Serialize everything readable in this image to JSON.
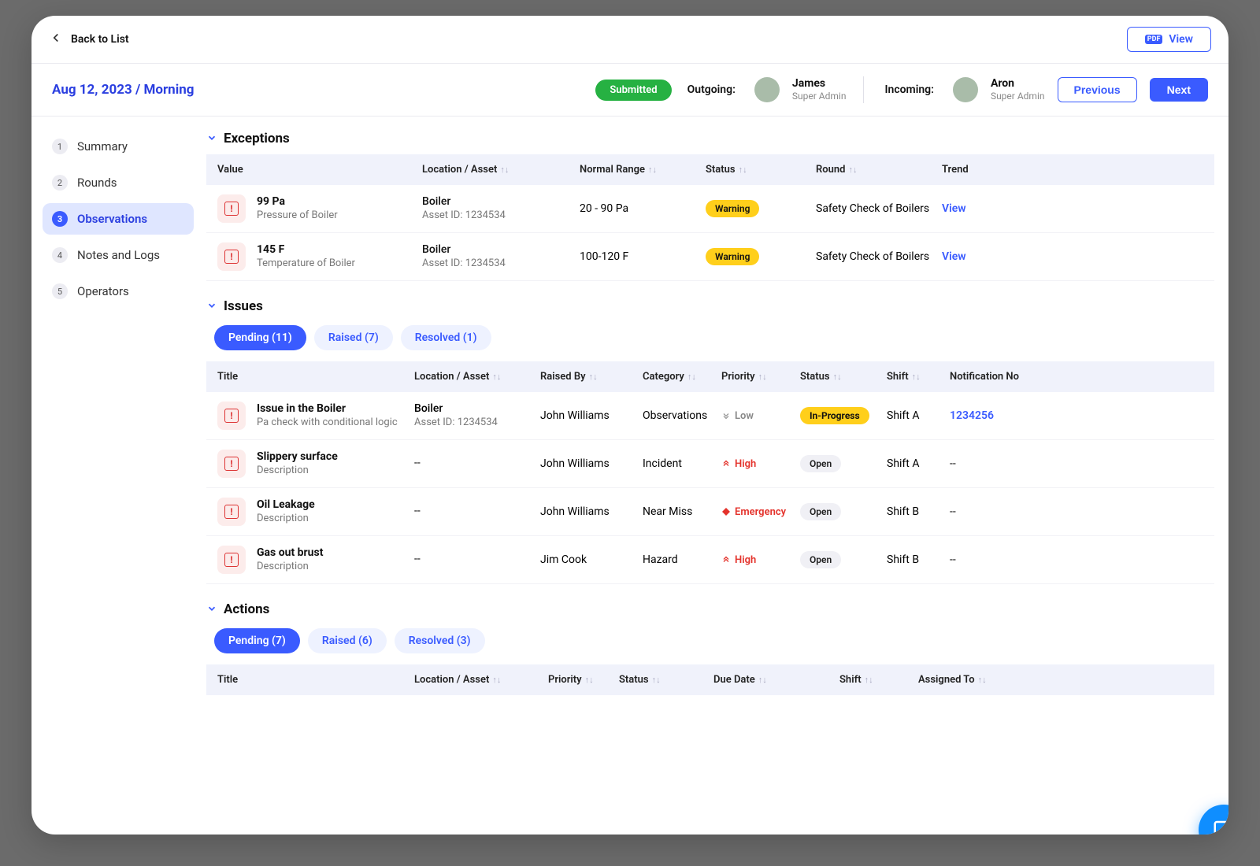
{
  "topbar": {
    "back": "Back to List",
    "view": "View",
    "pdf": "PDF"
  },
  "context": {
    "date": "Aug 12, 2023 / Morning",
    "submitted": "Submitted",
    "outgoing_label": "Outgoing:",
    "incoming_label": "Incoming:",
    "outgoing_name": "James",
    "outgoing_role": "Super Admin",
    "incoming_name": "Aron",
    "incoming_role": "Super Admin",
    "previous": "Previous",
    "next": "Next"
  },
  "sidebar": [
    {
      "num": "1",
      "label": "Summary"
    },
    {
      "num": "2",
      "label": "Rounds"
    },
    {
      "num": "3",
      "label": "Observations"
    },
    {
      "num": "4",
      "label": "Notes and Logs"
    },
    {
      "num": "5",
      "label": "Operators"
    }
  ],
  "exceptions": {
    "title": "Exceptions",
    "headers": {
      "value": "Value",
      "loc": "Location / Asset",
      "range": "Normal Range",
      "status": "Status",
      "round": "Round",
      "trend": "Trend"
    },
    "rows": [
      {
        "val": "99 Pa",
        "desc": "Pressure of Boiler",
        "loc": "Boiler",
        "asset": "Asset ID: 1234534",
        "range": "20 - 90 Pa",
        "status": "Warning",
        "round": "Safety Check of  Boilers",
        "trend": "View"
      },
      {
        "val": "145 F",
        "desc": "Temperature of Boiler",
        "loc": "Boiler",
        "asset": "Asset ID: 1234534",
        "range": "100-120 F",
        "status": "Warning",
        "round": "Safety Check of Boilers",
        "trend": "View"
      }
    ]
  },
  "issues": {
    "title": "Issues",
    "tabs": {
      "pending": "Pending (11)",
      "raised": "Raised (7)",
      "resolved": "Resolved (1)"
    },
    "headers": {
      "title": "Title",
      "loc": "Location / Asset",
      "raisedby": "Raised By",
      "category": "Category",
      "priority": "Priority",
      "status": "Status",
      "shift": "Shift",
      "notif": "Notification No"
    },
    "rows": [
      {
        "title": "Issue in the Boiler",
        "desc": "Pa check with conditional logic",
        "loc": "Boiler",
        "asset": "Asset ID: 1234534",
        "raisedby": "John Williams",
        "category": "Observations",
        "prio": "Low",
        "prio_type": "low",
        "status": "In-Progress",
        "status_type": "prog",
        "shift": "Shift A",
        "notif": "1234256"
      },
      {
        "title": "Slippery surface",
        "desc": "Description",
        "loc": "--",
        "asset": "",
        "raisedby": "John Williams",
        "category": "Incident",
        "prio": "High",
        "prio_type": "high",
        "status": "Open",
        "status_type": "open",
        "shift": "Shift A",
        "notif": "--"
      },
      {
        "title": "Oil Leakage",
        "desc": "Description",
        "loc": "--",
        "asset": "",
        "raisedby": "John Williams",
        "category": "Near Miss",
        "prio": "Emergency",
        "prio_type": "em",
        "status": "Open",
        "status_type": "open",
        "shift": "Shift B",
        "notif": "--"
      },
      {
        "title": "Gas out brust",
        "desc": "Description",
        "loc": "--",
        "asset": "",
        "raisedby": "Jim Cook",
        "category": "Hazard",
        "prio": "High",
        "prio_type": "high",
        "status": "Open",
        "status_type": "open",
        "shift": "Shift B",
        "notif": "--"
      }
    ]
  },
  "actions": {
    "title": "Actions",
    "tabs": {
      "pending": "Pending (7)",
      "raised": "Raised (6)",
      "resolved": "Resolved (3)"
    },
    "headers": {
      "title": "Title",
      "loc": "Location / Asset",
      "priority": "Priority",
      "status": "Status",
      "due": "Due Date",
      "shift": "Shift",
      "assigned": "Assigned To"
    }
  }
}
